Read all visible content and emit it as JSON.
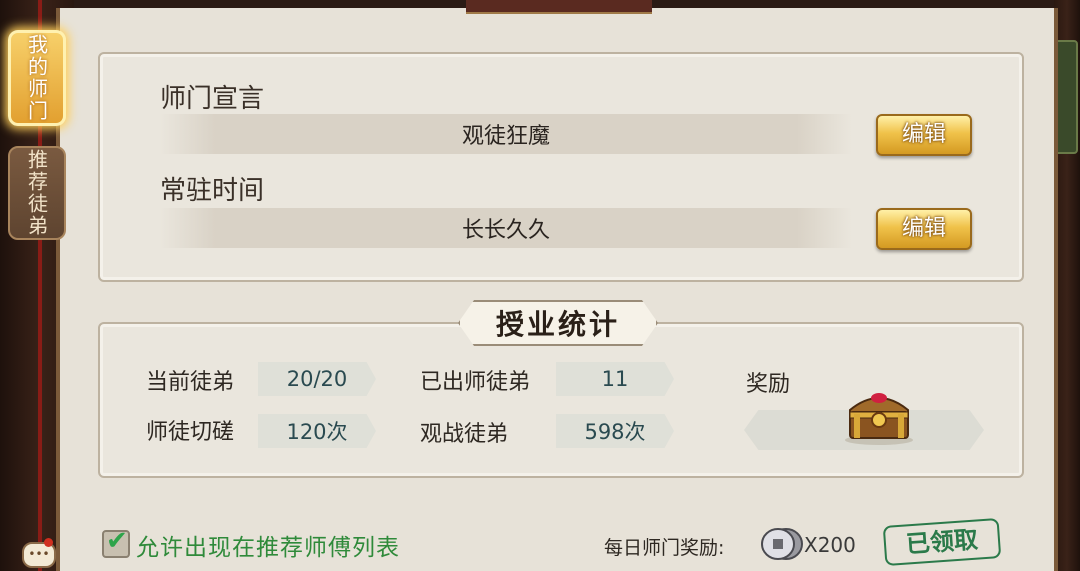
{
  "sidebar": {
    "tabs": [
      {
        "label": "我的师门",
        "active": true
      },
      {
        "label": "推荐徒弟",
        "active": false
      }
    ]
  },
  "declaration": {
    "label": "师门宣言",
    "value": "观徒狂魔",
    "edit_label": "编辑"
  },
  "resident_time": {
    "label": "常驻时间",
    "value": "长长久久",
    "edit_label": "编辑"
  },
  "stats": {
    "title": "授业统计",
    "current_disciples_label": "当前徒弟",
    "current_disciples_value": "20/20",
    "graduated_label": "已出师徒弟",
    "graduated_value": "11",
    "reward_label": "奖励",
    "sparring_label": "师徒切磋",
    "sparring_value": "120次",
    "spectate_label": "观战徒弟",
    "spectate_value": "598次"
  },
  "footer": {
    "allow_recommend_label": "允许出现在推荐师傅列表",
    "allow_recommend_checked": true,
    "daily_reward_label": "每日师门奖励:",
    "daily_reward_count": "X200",
    "claimed_label": "已领取"
  },
  "colors": {
    "parchment": "#e7e2d8",
    "gold_button": "#f0c24a",
    "frame_wood": "#3a2218",
    "green_text": "#2f8a3a",
    "stamp_green": "#2b7a4a"
  },
  "icons": {
    "chest": "treasure-chest-icon",
    "coin": "silver-coin-icon",
    "chat": "chat-bubble-icon",
    "check": "check-icon"
  }
}
